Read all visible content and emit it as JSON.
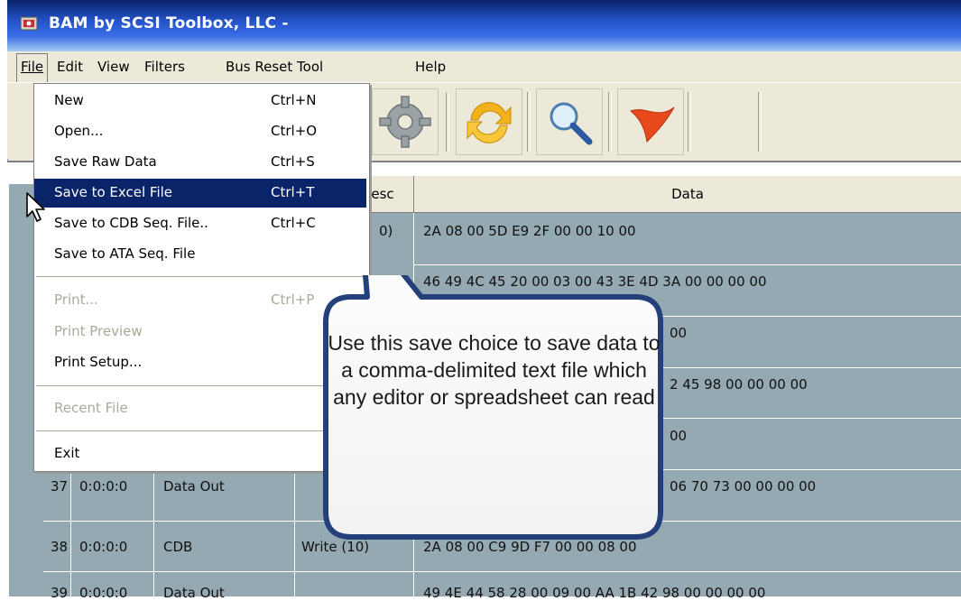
{
  "window": {
    "title": "BAM by SCSI Toolbox, LLC -"
  },
  "menubar": {
    "items": [
      "File",
      "Edit",
      "View",
      "Filters",
      "Bus Reset Tool",
      "Help"
    ]
  },
  "toolbar": {
    "buttons": [
      "gear-icon",
      "refresh-icon",
      "magnifier-icon",
      "flag-icon"
    ]
  },
  "file_menu": {
    "items": [
      {
        "label": "New",
        "shortcut": "Ctrl+N",
        "enabled": true
      },
      {
        "label": "Open...",
        "shortcut": "Ctrl+O",
        "enabled": true
      },
      {
        "label": "Save Raw Data",
        "shortcut": "Ctrl+S",
        "enabled": true
      },
      {
        "label": "Save to Excel File",
        "shortcut": "Ctrl+T",
        "enabled": true,
        "selected": true
      },
      {
        "label": "Save to CDB Seq. File..",
        "shortcut": "Ctrl+C",
        "enabled": true
      },
      {
        "label": "Save to ATA Seq. File",
        "shortcut": "",
        "enabled": true
      },
      {
        "label": "Print...",
        "shortcut": "Ctrl+P",
        "enabled": false
      },
      {
        "label": "Print Preview",
        "shortcut": "",
        "enabled": false
      },
      {
        "label": "Print Setup...",
        "shortcut": "",
        "enabled": true
      },
      {
        "label": "Recent File",
        "shortcut": "",
        "enabled": false
      },
      {
        "label": "Exit",
        "shortcut": "",
        "enabled": true
      }
    ]
  },
  "table": {
    "headers": [
      "esc",
      "Data"
    ],
    "rows": [
      {
        "num": "",
        "id": "",
        "type": "",
        "desc": "0)",
        "data": "2A 08 00 5D E9 2F 00 00 10 00"
      },
      {
        "num": "",
        "id": "",
        "type": "",
        "desc": "",
        "data": "46 49 4C 45 20 00 03 00 43 3E 4D 3A 00 00 00 00"
      },
      {
        "num": "",
        "id": "",
        "type": "",
        "desc": "",
        "data": "00"
      },
      {
        "num": "",
        "id": "",
        "type": "",
        "desc": "",
        "data": "2 45 98 00 00 00 00"
      },
      {
        "num": "",
        "id": "",
        "type": "",
        "desc": "",
        "data": "00"
      },
      {
        "num": "37",
        "id": "0:0:0:0",
        "type": "Data Out",
        "desc": "",
        "data": "06 70 73 00 00 00 00"
      },
      {
        "num": "38",
        "id": "0:0:0:0",
        "type": "CDB",
        "desc": "Write (10)",
        "data": "2A 08 00 C9 9D F7 00 00 08 00"
      },
      {
        "num": "39",
        "id": "0:0:0:0",
        "type": "Data Out",
        "desc": "",
        "data": "49 4E 44 58 28 00 09 00 AA 1B 42 98 00 00 00 00"
      }
    ]
  },
  "callout": {
    "text": "Use this save choice to save data to a comma-delimited text file which any editor or spreadsheet can read"
  },
  "colors": {
    "title_bar": "#0a246a",
    "menu_highlight": "#0a246a",
    "grid_background": "#94a9b1",
    "callout_border": "#24407a"
  }
}
